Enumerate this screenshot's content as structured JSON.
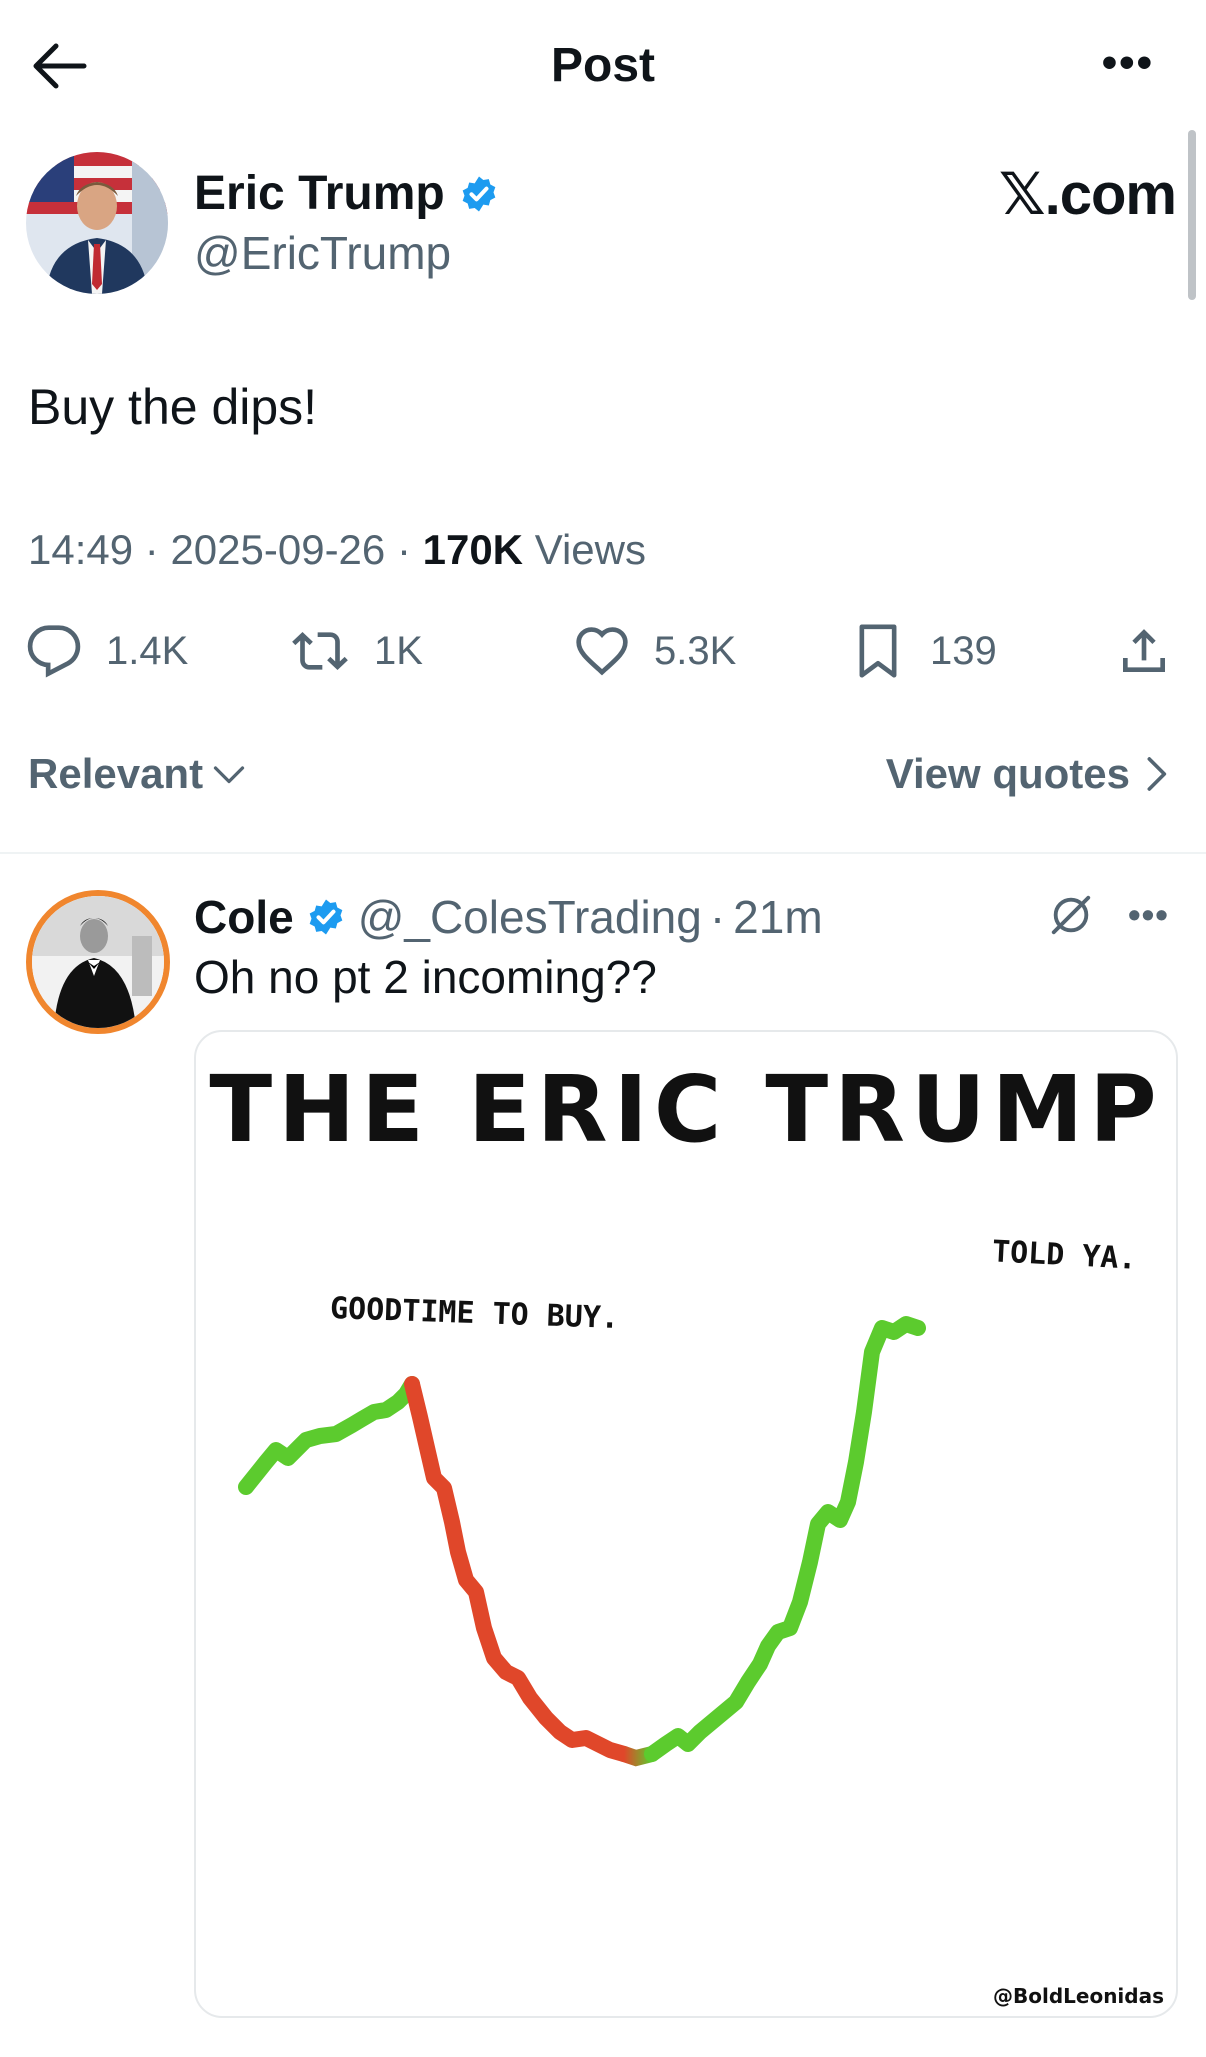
{
  "header": {
    "title": "Post"
  },
  "post": {
    "author_name": "Eric Trump",
    "author_handle": "@EricTrump",
    "watermark": "𝕏.com",
    "text": "Buy the dips!",
    "time": "14:49",
    "date": "2025-09-26",
    "views_count": "170K",
    "views_label": "Views",
    "replies": "1.4K",
    "reposts": "1K",
    "likes": "5.3K",
    "bookmarks": "139"
  },
  "sort": {
    "relevant_label": "Relevant",
    "view_quotes_label": "View quotes"
  },
  "reply": {
    "name": "Cole",
    "handle": "@_ColesTrading",
    "time": "21m",
    "text": "Oh no pt 2 incoming??",
    "image": {
      "title": "THE ERIC TRUMP",
      "label_left": "GOODTIME TO BUY.",
      "label_right": "TOLD YA.",
      "credit": "@BoldLeonidas"
    }
  },
  "colors": {
    "text_primary": "#0f1419",
    "text_secondary": "#536471",
    "verified_blue": "#1d9bf0",
    "avatar_ring": "#f0862e",
    "line_green": "#5ccb2e",
    "line_red": "#e0472a"
  },
  "icons": [
    "back-arrow-icon",
    "more-icon",
    "verified-icon",
    "reply-icon",
    "repost-icon",
    "like-icon",
    "bookmark-icon",
    "share-icon",
    "chevron-down-icon",
    "chevron-right-icon",
    "grok-icon"
  ]
}
